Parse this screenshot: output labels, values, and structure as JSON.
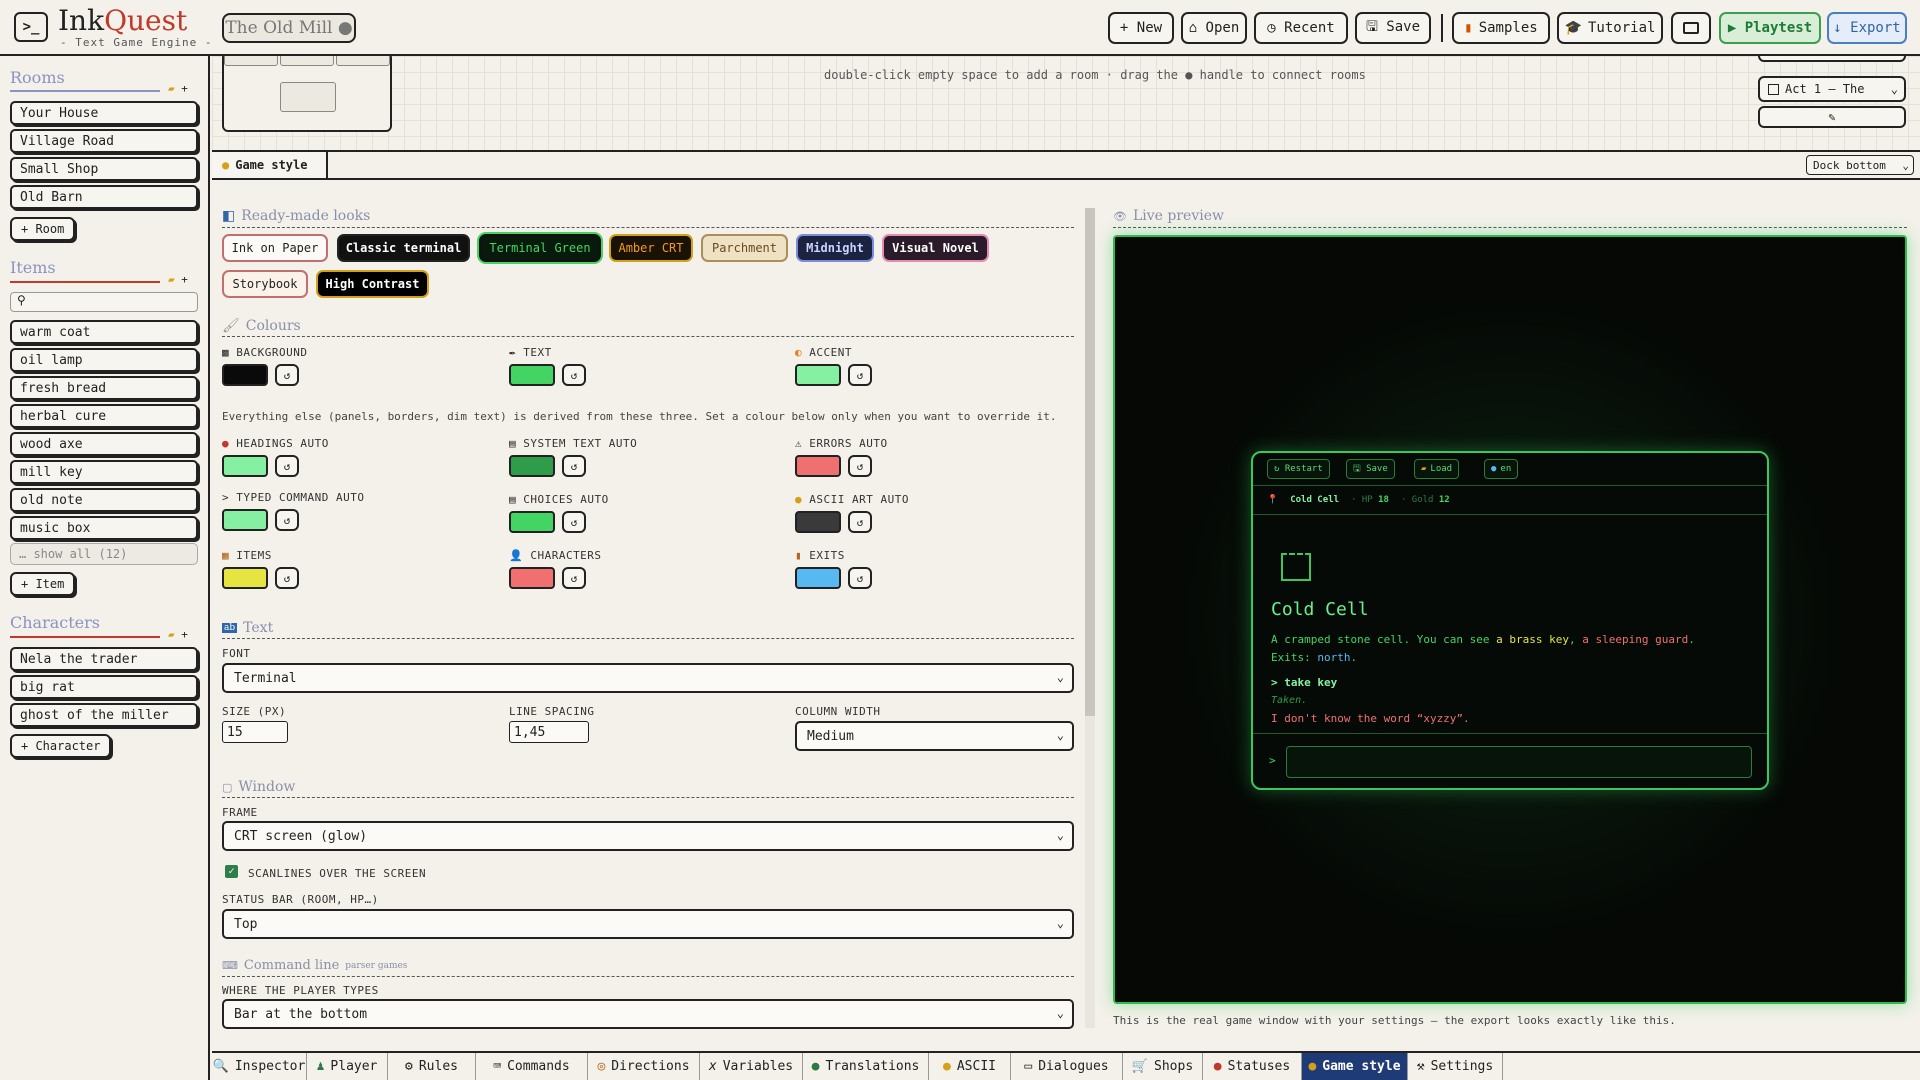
{
  "app": {
    "name_ink": "Ink",
    "name_quest": "Quest",
    "subtitle": "- Text Game Engine -",
    "project": "The Old Mill ●"
  },
  "toolbar": {
    "new": "+ New",
    "open": "⌂ Open",
    "recent": "◷ Recent",
    "save": "🖫 Save",
    "samples": "Samples",
    "tutorial": "Tutorial",
    "playtest": "▶ Playtest",
    "export": "↓ Export"
  },
  "sidebar": {
    "rooms_title": "Rooms",
    "rooms": [
      "Your House",
      "Village Road",
      "Small Shop",
      "Old Barn"
    ],
    "add_room": "+ Room",
    "items_title": "Items",
    "items": [
      "warm coat",
      "oil lamp",
      "fresh bread",
      "herbal cure",
      "wood axe",
      "mill key",
      "old note",
      "music box"
    ],
    "items_more": "… show all (12)",
    "add_item": "+ Item",
    "characters_title": "Characters",
    "characters": [
      "Nela the trader",
      "big rat",
      "ghost of the miller"
    ],
    "add_character": "+ Character"
  },
  "map": {
    "hint": "double-click empty space to add a room · drag the ● handle to connect rooms",
    "act_select": "Act 1 — The"
  },
  "panel": {
    "tab": "Game style",
    "dock": "Dock bottom"
  },
  "style": {
    "presets_title": "Ready-made looks",
    "presets": [
      "Ink on Paper",
      "Classic terminal",
      "Terminal Green",
      "Amber CRT",
      "Parchment",
      "Midnight",
      "Visual Novel",
      "Storybook",
      "High Contrast"
    ],
    "colours_title": "Colours",
    "base_colours": [
      {
        "label": "BACKGROUND",
        "color": "#0a0a0a"
      },
      {
        "label": "TEXT",
        "color": "#43d463"
      },
      {
        "label": "ACCENT",
        "color": "#86f0a2"
      }
    ],
    "derived_note": "Everything else (panels, borders, dim text) is derived from these three. Set a colour below only when you want to override it.",
    "override_colours": [
      {
        "label": "HEADINGS AUTO",
        "color": "#86f0a2"
      },
      {
        "label": "SYSTEM TEXT AUTO",
        "color": "#2e9c48"
      },
      {
        "label": "ERRORS AUTO",
        "color": "#f07070"
      },
      {
        "label": "> TYPED COMMAND AUTO",
        "color": "#86f0a2"
      },
      {
        "label": "CHOICES AUTO",
        "color": "#43d463"
      },
      {
        "label": "ASCII ART AUTO",
        "color": "#3a3a3a"
      },
      {
        "label": "ITEMS",
        "color": "#e5e440"
      },
      {
        "label": "CHARACTERS",
        "color": "#f07070"
      },
      {
        "label": "EXITS",
        "color": "#58b8f0"
      }
    ],
    "text_title": "Text",
    "font_label": "FONT",
    "font_value": "Terminal",
    "size_label": "SIZE (PX)",
    "size_value": "15",
    "spacing_label": "LINE SPACING",
    "spacing_value": "1,45",
    "width_label": "COLUMN WIDTH",
    "width_value": "Medium",
    "window_title": "Window",
    "frame_label": "FRAME",
    "frame_value": "CRT screen (glow)",
    "scanlines_label": "SCANLINES OVER THE SCREEN",
    "statusbar_label": "STATUS BAR (ROOM, HP…)",
    "statusbar_value": "Top",
    "cmd_title": "Command line",
    "cmd_sub": "parser games",
    "where_label": "WHERE THE PLAYER TYPES",
    "where_value": "Bar at the bottom"
  },
  "preview": {
    "title": "Live preview",
    "note": "This is the real game window with your settings — the export looks exactly like this.",
    "buttons": [
      "↻ Restart",
      "🖫 Save",
      "Load",
      "en"
    ],
    "status_room": "Cold Cell",
    "hp_label": "· HP",
    "hp": "18",
    "gold_label": "· Gold",
    "gold": "12",
    "room": "Cold Cell",
    "desc_start": "A cramped stone cell. You can see ",
    "desc_item": "a brass key",
    "desc_sep": ", ",
    "desc_char": "a sleeping guard",
    "desc_end": ".",
    "exits_label": "Exits: ",
    "exits_value": "north",
    "exits_end": ".",
    "command": "> take key",
    "response": "Taken.",
    "error": "I don't know the word “xyzzy”.",
    "prompt": ">"
  },
  "bottom_tabs": [
    "Inspector",
    "Player",
    "Rules",
    "Commands",
    "Directions",
    "Variables",
    "Translations",
    "ASCII",
    "Dialogues",
    "Shops",
    "Statuses",
    "Game style",
    "Settings"
  ]
}
